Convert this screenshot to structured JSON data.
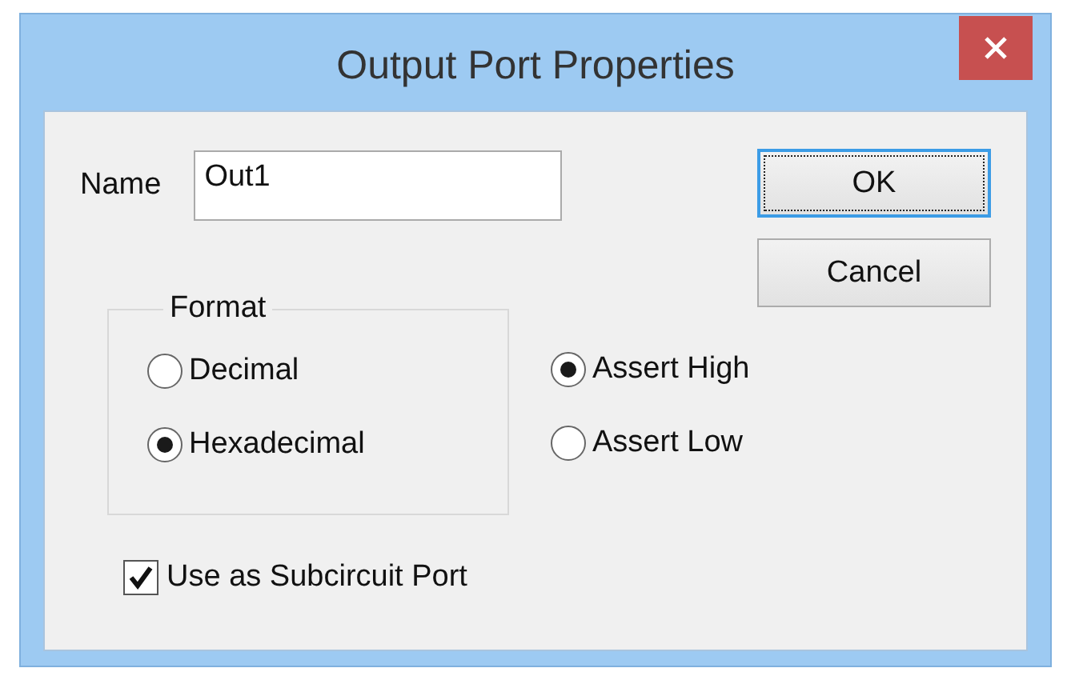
{
  "window": {
    "title": "Output Port Properties"
  },
  "name_field": {
    "label": "Name",
    "value": "Out1"
  },
  "buttons": [
    {
      "label": "OK",
      "default": true
    },
    {
      "label": "Cancel",
      "default": false
    }
  ],
  "format": {
    "title": "Format",
    "options": [
      {
        "label": "Decimal",
        "selected": false
      },
      {
        "label": "Hexadecimal",
        "selected": true
      }
    ]
  },
  "assert": [
    {
      "label": "Assert High",
      "selected": true
    },
    {
      "label": "Assert Low",
      "selected": false
    }
  ],
  "subcircuit": {
    "label": "Use as Subcircuit Port",
    "checked": true
  }
}
